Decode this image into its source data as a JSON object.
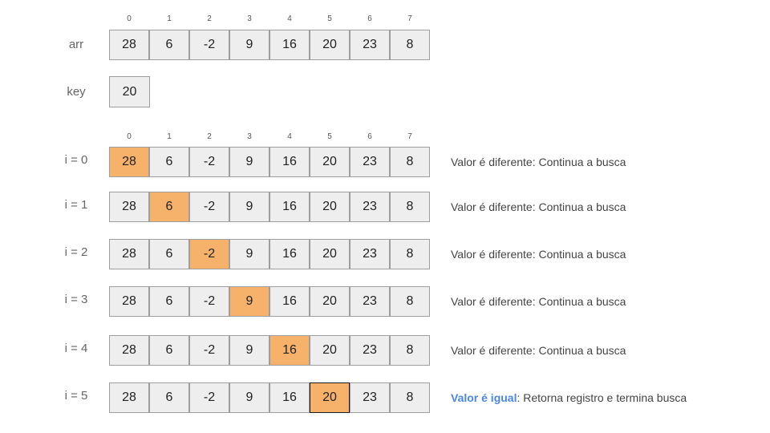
{
  "array_label": "arr",
  "key_label": "key",
  "key_value": "20",
  "indices": [
    "0",
    "1",
    "2",
    "3",
    "4",
    "5",
    "6",
    "7"
  ],
  "array_values": [
    "28",
    "6",
    "-2",
    "9",
    "16",
    "20",
    "23",
    "8"
  ],
  "highlight_color": "#f6b26b",
  "cell_color": "#eeeeee",
  "match_color": "#4a86e8",
  "steps": [
    {
      "label": "i = 0",
      "highlight": 0,
      "message": "Valor é diferente: Continua a busca"
    },
    {
      "label": "i = 1",
      "highlight": 1,
      "message": "Valor é diferente: Continua a busca"
    },
    {
      "label": "i = 2",
      "highlight": 2,
      "message": "Valor é diferente: Continua a busca"
    },
    {
      "label": "i = 3",
      "highlight": 3,
      "message": "Valor é diferente: Continua a busca"
    },
    {
      "label": "i = 4",
      "highlight": 4,
      "message": "Valor é diferente: Continua a busca"
    },
    {
      "label": "i = 5",
      "highlight": 5,
      "message_strong": "Valor é igual",
      "message": ": Retorna registro e termina busca"
    }
  ]
}
